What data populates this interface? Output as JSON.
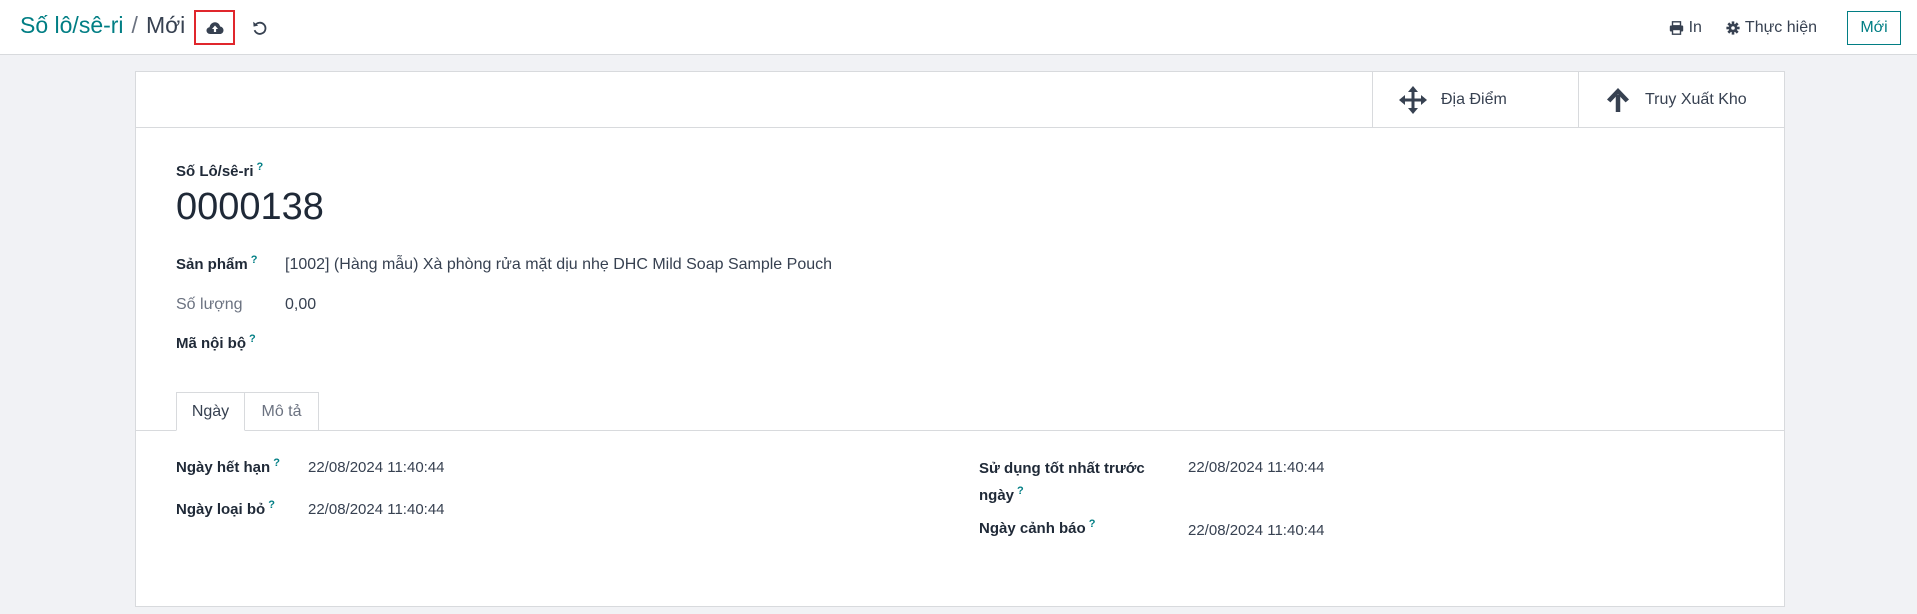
{
  "breadcrumb": {
    "parent": "Số lô/sê-ri",
    "separator": "/",
    "current": "Mới"
  },
  "header": {
    "save_icon": "cloud-upload-icon",
    "discard_icon": "undo-icon",
    "print_label": "In",
    "action_label": "Thực hiện",
    "new_label": "Mới"
  },
  "smart_buttons": {
    "location_label": "Địa Điểm",
    "traceability_label": "Truy Xuất Kho"
  },
  "form": {
    "lot_label": "Số Lô/sê-ri",
    "lot_name": "0000138",
    "product_label": "Sản phẩm",
    "product_value": "[1002] (Hàng mẫu) Xà phòng rửa mặt dịu nhẹ DHC Mild Soap Sample Pouch",
    "quantity_label": "Số lượng",
    "quantity_value": "0,00",
    "internal_ref_label": "Mã nội bộ",
    "help_mark": "?"
  },
  "tabs": [
    {
      "label": "Ngày",
      "active": true
    },
    {
      "label": "Mô tả",
      "active": false
    }
  ],
  "dates": {
    "expiration_label": "Ngày hết hạn",
    "expiration_value": "22/08/2024 11:40:44",
    "removal_label": "Ngày loại bỏ",
    "removal_value": "22/08/2024 11:40:44",
    "use_before_label_line1": "Sử dụng tốt nhất trước",
    "use_before_label_line2": "ngày",
    "use_before_value": "22/08/2024 11:40:44",
    "alert_label": "Ngày cảnh báo",
    "alert_value": "22/08/2024 11:40:44"
  },
  "colors": {
    "accent": "#017e84",
    "highlight_box": "#e0262c"
  }
}
